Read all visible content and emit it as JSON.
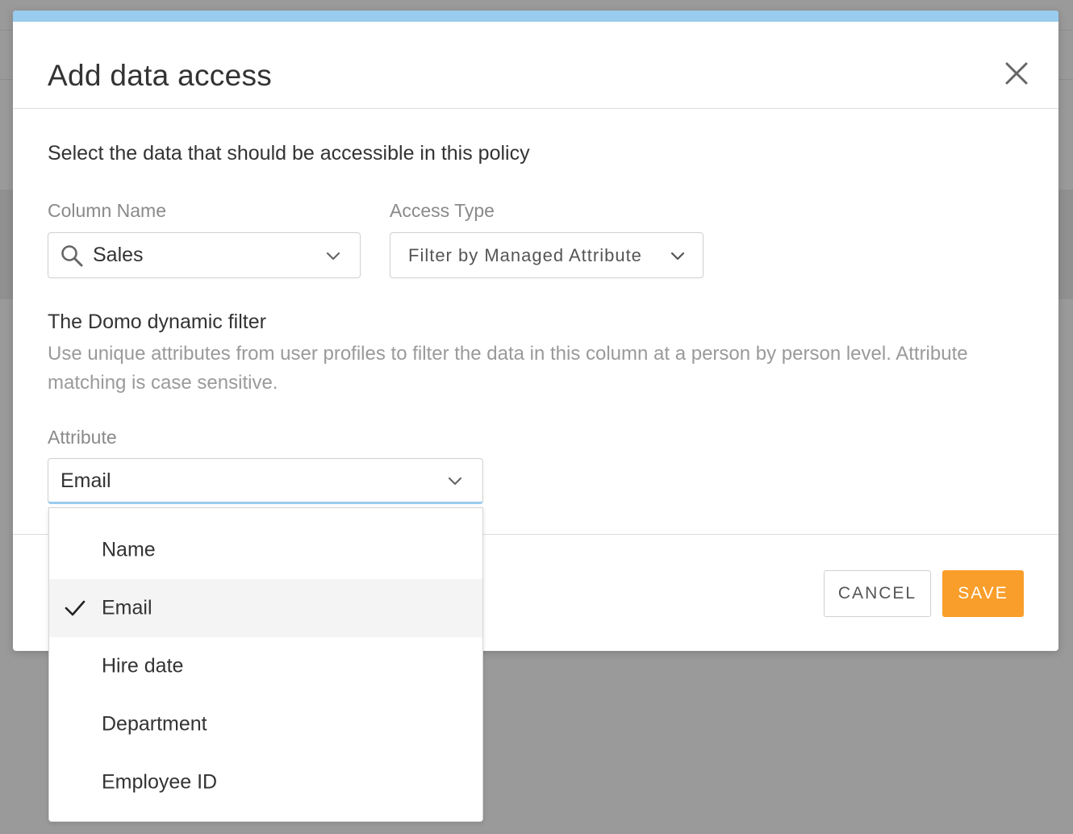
{
  "modal": {
    "title": "Add data access",
    "accent_color": "#99ccee"
  },
  "form": {
    "instruction": "Select the data that should be accessible in this policy",
    "column_name": {
      "label": "Column Name",
      "value": "Sales",
      "icon": "search-icon"
    },
    "access_type": {
      "label": "Access Type",
      "value": "Filter by Managed Attribute"
    },
    "dynamic_filter": {
      "title": "The Domo dynamic filter",
      "description": "Use unique attributes from user profiles to filter the data in this column at a person by person level. Attribute matching is case sensitive."
    },
    "attribute": {
      "label": "Attribute",
      "value": "Email",
      "options": [
        {
          "label": "Name",
          "selected": false
        },
        {
          "label": "Email",
          "selected": true
        },
        {
          "label": "Hire date",
          "selected": false
        },
        {
          "label": "Department",
          "selected": false
        },
        {
          "label": "Employee ID",
          "selected": false
        }
      ]
    }
  },
  "footer": {
    "cancel_label": "CANCEL",
    "save_label": "SAVE",
    "save_color": "#f99e2a"
  }
}
